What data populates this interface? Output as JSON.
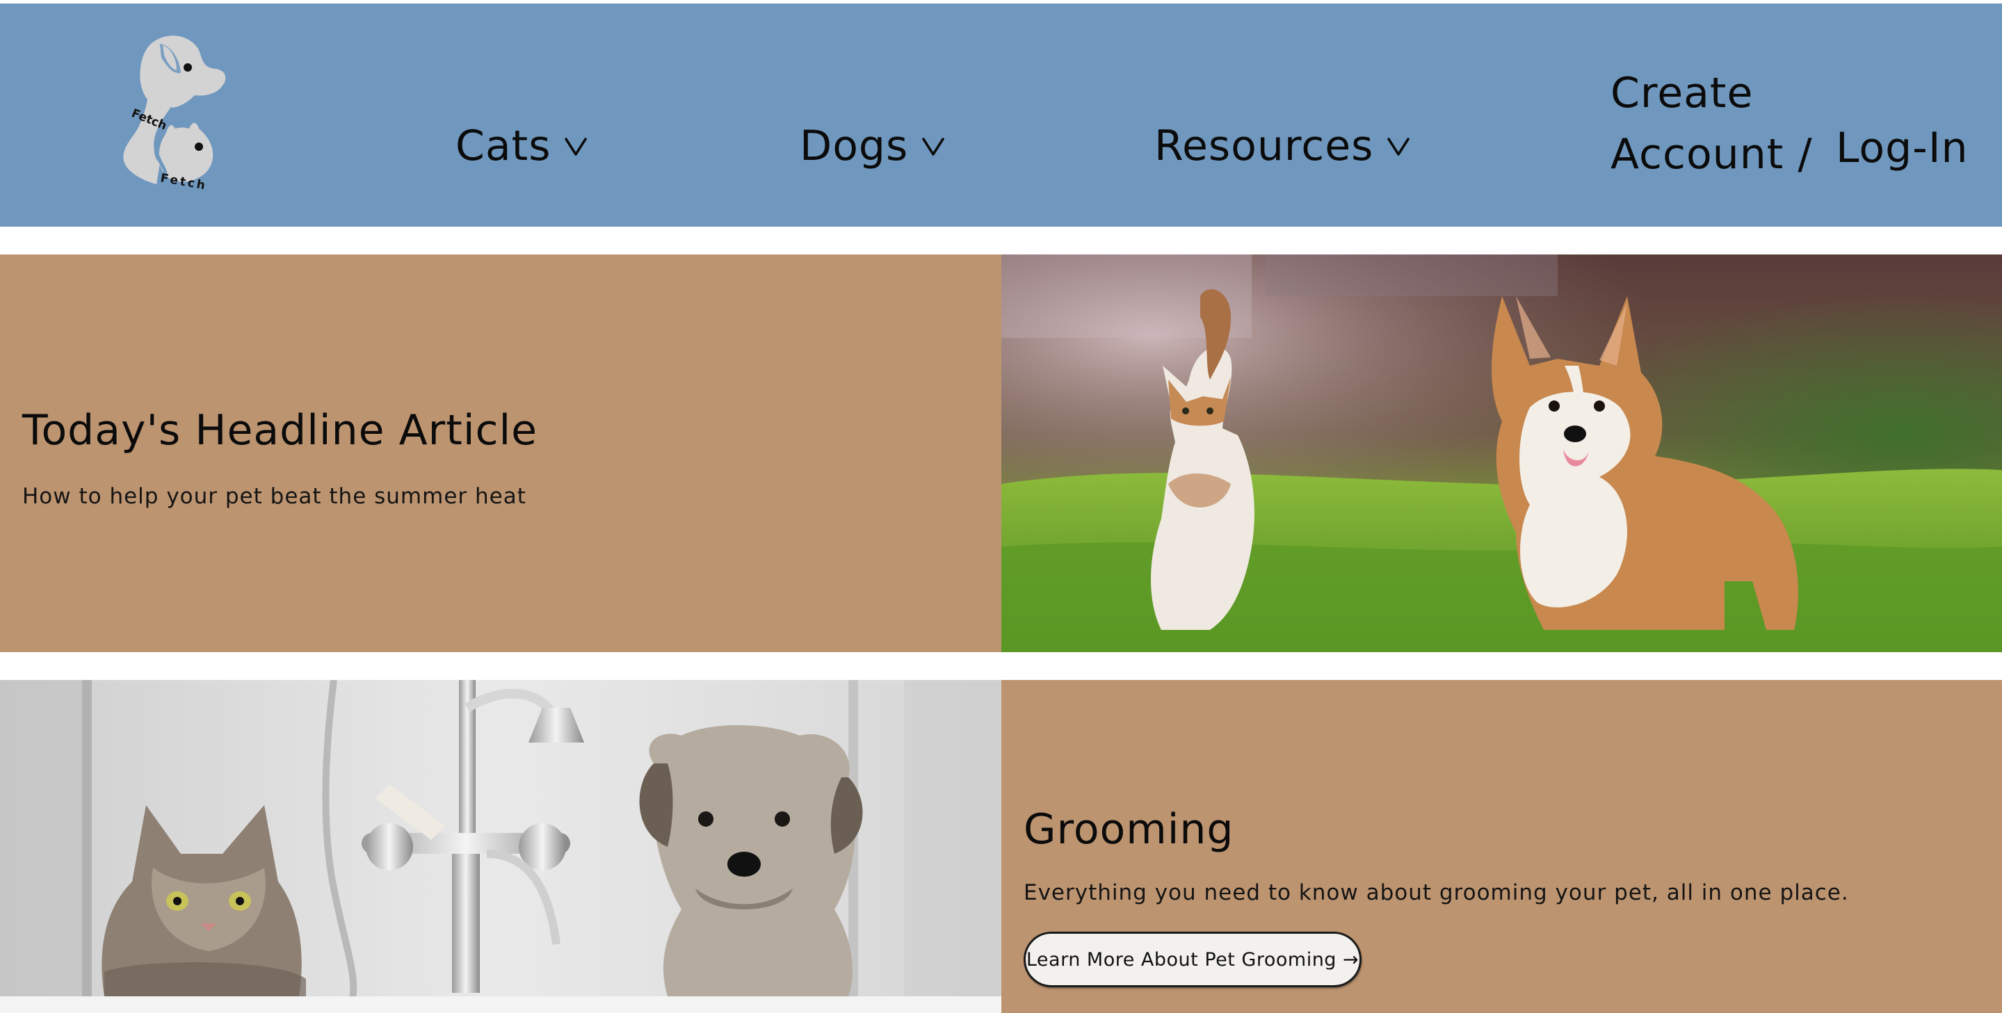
{
  "header": {
    "background_color": "#7098be",
    "logo": {
      "text_top": "Fetch",
      "text_bottom": "Fetch",
      "icon": "dog-and-cat-silhouette-logo"
    },
    "nav": {
      "cats_label": "Cats",
      "dogs_label": "Dogs",
      "resources_label": "Resources",
      "dropdown_icon": "chevron-down-icon",
      "create_account_line1": "Create",
      "create_account_line2": "Account /",
      "login_label": "Log-In"
    }
  },
  "headline_section": {
    "panel_color": "#bd9470",
    "title": "Today's Headline Article",
    "subtitle": "How to help your pet beat the summer heat",
    "photo": "corgi-and-calico-cat-on-grass-photo"
  },
  "grooming_section": {
    "panel_color": "#bd9470",
    "photo": "cat-and-dog-in-bathtub-photo",
    "title": "Grooming",
    "subtitle": "Everything you need to know about grooming your pet, all in one place.",
    "button_label": "Learn More About Pet Grooming →"
  }
}
